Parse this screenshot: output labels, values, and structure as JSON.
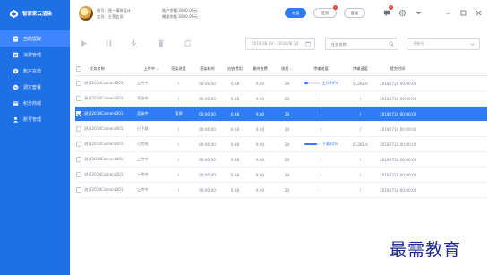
{
  "app": {
    "name": "智家家云渲染",
    "accent": "#1f6fe5",
    "selected_row_color": "#2f7cf6"
  },
  "sidebar": {
    "items": [
      {
        "label": "自助提取",
        "icon": "document-icon",
        "active": true
      },
      {
        "label": "消费管理",
        "icon": "list-icon",
        "active": false
      },
      {
        "label": "账户充值",
        "icon": "coin-icon",
        "active": false
      },
      {
        "label": "调定套餐",
        "icon": "wave-icon",
        "active": false
      },
      {
        "label": "积分商城",
        "icon": "card-icon",
        "active": false
      },
      {
        "label": "账号管理",
        "icon": "user-icon",
        "active": false
      }
    ]
  },
  "header": {
    "user_account_label": "账号:",
    "user_account_value": "逐一精致设计",
    "membership_label": "会员:",
    "membership_value": "主营会员",
    "balance_label": "账户余额:",
    "balance_value": "3000.00元",
    "gift_label": "赠送余额:",
    "gift_value": "3000.00元",
    "recharge_button": "充值",
    "sign_button": "签到",
    "sign_badge": "1",
    "notice_button": "客服",
    "message_badge": "1"
  },
  "toolbar": {
    "date_range": "2018.08.09 - 2018.08.14",
    "search_placeholder": "任务名称",
    "select_placeholder": "子账号"
  },
  "table": {
    "columns": [
      "任务名称",
      "上传中",
      "渲染进度",
      "渲染耗时",
      "应收费用",
      "最终收费",
      "线程",
      "传输进度",
      "传输速度",
      "提交时间"
    ],
    "rows": [
      {
        "name": "测试2014Camera001",
        "status": "上传中",
        "render": "/",
        "time": "00:00:00",
        "fee": "0.88",
        "final": "9.00",
        "threads": "24",
        "transfer": "上传24%",
        "progress": 0.24,
        "speed": "512KB/s",
        "submit": "20180718 00:00:00",
        "selected": false
      },
      {
        "name": "测试2014Camera001",
        "status": "渲染中",
        "render": "/",
        "time": "00:00:00",
        "fee": "0.88",
        "final": "9.00",
        "threads": "24",
        "transfer": "/",
        "progress": null,
        "speed": "/",
        "submit": "20180718 00:00:00",
        "selected": false
      },
      {
        "name": "测试2014Camera001",
        "status": "渲染中",
        "render": "暂停",
        "time": "00:00:00",
        "fee": "0.88",
        "final": "9.00",
        "threads": "24",
        "transfer": "/",
        "progress": null,
        "speed": "/",
        "submit": "20180718 00:00:00",
        "selected": true
      },
      {
        "name": "测试2014Camera001",
        "status": "已下载",
        "render": "/",
        "time": "00:00:00",
        "fee": "0.88",
        "final": "9.00",
        "threads": "24",
        "transfer": "/",
        "progress": null,
        "speed": "/",
        "submit": "20180718 00:00:00",
        "selected": false
      },
      {
        "name": "测试2014Camera001",
        "status": "已完成",
        "render": "/",
        "time": "00:00:00",
        "fee": "0.88",
        "final": "9.00",
        "threads": "24",
        "transfer": "下载82%",
        "progress": 0.82,
        "speed": "512KB/s",
        "submit": "20180718 00:00:00",
        "selected": false
      },
      {
        "name": "测试2014Camera001",
        "status": "上传中",
        "render": "/",
        "time": "00:00:00",
        "fee": "0.88",
        "final": "9.00",
        "threads": "24",
        "transfer": "/",
        "progress": null,
        "speed": "/",
        "submit": "20180718 00:00:00",
        "selected": false
      },
      {
        "name": "测试2014Camera001",
        "status": "上传中",
        "render": "/",
        "time": "00:00:00",
        "fee": "0.88",
        "final": "9.00",
        "threads": "24",
        "transfer": "/",
        "progress": null,
        "speed": "/",
        "submit": "20180718 00:00:00",
        "selected": false
      },
      {
        "name": "测试2014Camera001",
        "status": "上传中",
        "render": "/",
        "time": "00:00:00",
        "fee": "0.88",
        "final": "9.00",
        "threads": "24",
        "transfer": "/",
        "progress": null,
        "speed": "/",
        "submit": "20180718 00:00:00",
        "selected": false
      }
    ]
  },
  "watermark": "最需教育"
}
